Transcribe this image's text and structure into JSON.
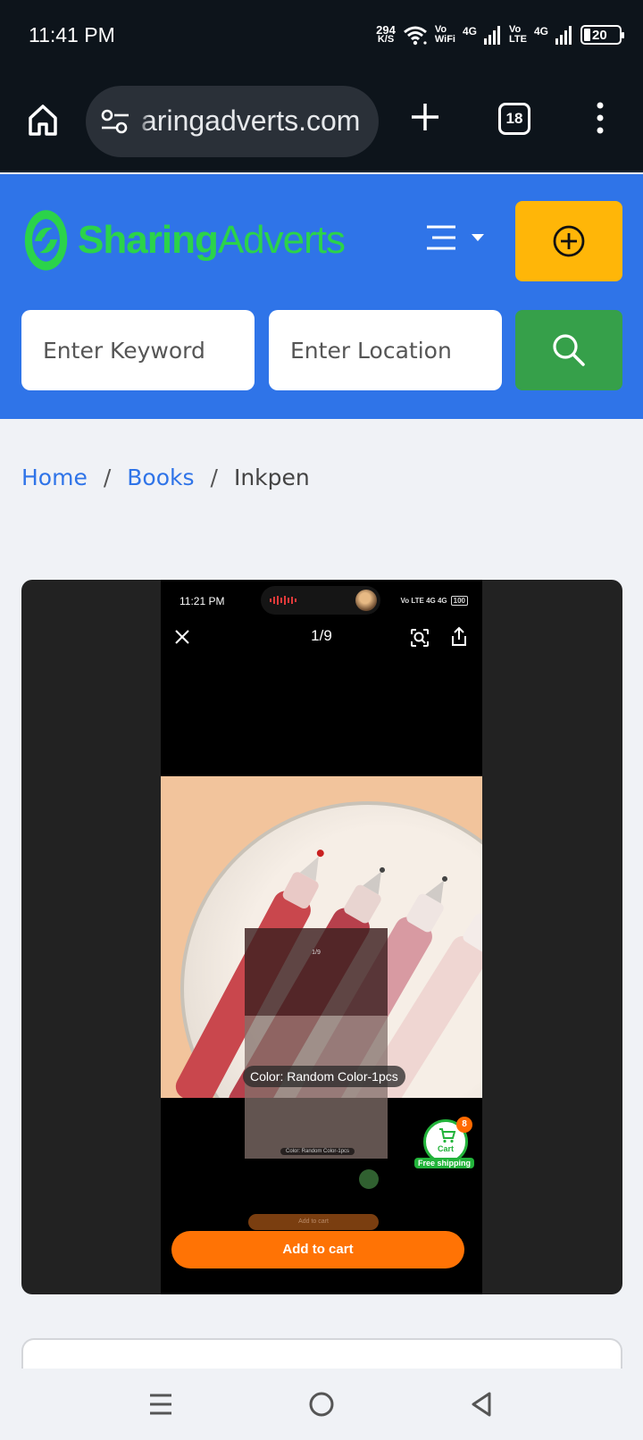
{
  "status_bar": {
    "time": "11:41 PM",
    "net_speed_value": "294",
    "net_speed_unit": "K/S",
    "vowifi_top": "Vo",
    "vowifi_bottom": "WiFi",
    "volte_top": "Vo",
    "volte_bottom": "LTE",
    "network_1": "4G",
    "network_2": "4G",
    "battery": "20"
  },
  "browser": {
    "url": "aringadverts.com",
    "tab_count": "18"
  },
  "site": {
    "logo_part1": "Sharing",
    "logo_part2": "Adverts",
    "keyword_placeholder": "Enter Keyword",
    "location_placeholder": "Enter Location"
  },
  "breadcrumb": {
    "home": "Home",
    "category": "Books",
    "current": "Inkpen",
    "separator": "/"
  },
  "product_image": {
    "inner_time": "11:21 PM",
    "inner_status": "Vo LTE 4G 4G",
    "inner_battery": "100",
    "counter": "1/9",
    "mini_counter": "1/9",
    "color_label": "Color: Random Color-1pcs",
    "mini_color_label": "Color: Random Color-1pcs",
    "cart_label": "Cart",
    "cart_count": "8",
    "free_shipping": "Free shipping",
    "mini_add_to_cart": "Add to cart",
    "add_to_cart": "Add to cart"
  },
  "colors": {
    "header_blue": "#2f74e8",
    "logo_green": "#2bd34a",
    "post_yellow": "#ffb608",
    "search_green": "#36a04a",
    "cart_orange": "#ff7305"
  }
}
